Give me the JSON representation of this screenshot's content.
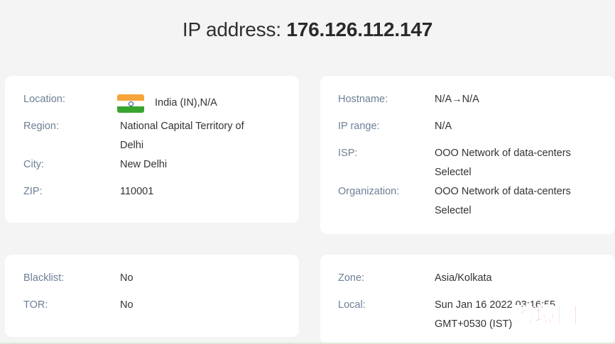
{
  "header": {
    "title_prefix": "IP address:",
    "ip": "176.126.112.147"
  },
  "geo_card": {
    "location_label": "Location:",
    "location_flag_icon": "india-flag-icon",
    "location_value": "India (IN),N/A",
    "region_label": "Region:",
    "region_line1": "National Capital Territory of",
    "region_line2": "Delhi",
    "city_label": "City:",
    "city_value": "New Delhi",
    "zip_label": "ZIP:",
    "zip_value": "110001"
  },
  "network_card": {
    "hostname_label": "Hostname:",
    "hostname_value": "N/A→N/A",
    "iprange_label": "IP range:",
    "iprange_value": "N/A",
    "isp_label": "ISP:",
    "isp_line1": "OOO Network of data-centers",
    "isp_line2": "Selectel",
    "org_label": "Organization:",
    "org_line1": "OOO Network of data-centers",
    "org_line2": "Selectel"
  },
  "security_card": {
    "blacklist_label": "Blacklist:",
    "blacklist_value": "No",
    "tor_label": "TOR:",
    "tor_value": "No"
  },
  "time_card": {
    "zone_label": "Zone:",
    "zone_value": "Asia/Kolkata",
    "local_label": "Local:",
    "local_line1": "Sun Jan 16 2022 03:16:55",
    "local_line2": "GMT+0530 (IST)"
  },
  "watermark": {
    "text": "跨境圈"
  },
  "colors": {
    "label": "#6c7f95",
    "value": "#333333",
    "card": "#ffffff",
    "page": "#f3f4f3",
    "watermark": "#e3232b"
  }
}
